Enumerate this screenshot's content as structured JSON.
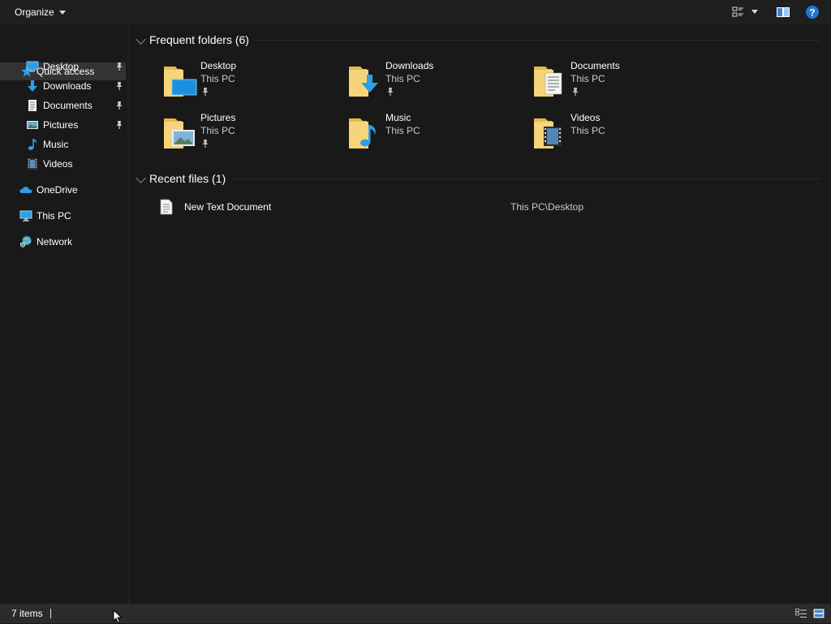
{
  "toolbar": {
    "organize_label": "Organize",
    "icons": [
      "view-options-icon",
      "preview-pane-icon",
      "help-icon"
    ]
  },
  "sidebar": {
    "quick_access": "Quick access",
    "pinned": [
      {
        "label": "Desktop",
        "icon": "desktop-icon"
      },
      {
        "label": "Downloads",
        "icon": "downloads-icon"
      },
      {
        "label": "Documents",
        "icon": "documents-icon"
      },
      {
        "label": "Pictures",
        "icon": "pictures-icon"
      }
    ],
    "items": [
      {
        "label": "Music",
        "icon": "music-icon"
      },
      {
        "label": "Videos",
        "icon": "videos-icon"
      }
    ],
    "onedrive": "OneDrive",
    "this_pc": "This PC",
    "network": "Network"
  },
  "frequent": {
    "title": "Frequent folders (6)",
    "folders": [
      {
        "name": "Desktop",
        "location": "This PC",
        "pinned": true
      },
      {
        "name": "Downloads",
        "location": "This PC",
        "pinned": true
      },
      {
        "name": "Documents",
        "location": "This PC",
        "pinned": true
      },
      {
        "name": "Pictures",
        "location": "This PC",
        "pinned": true
      },
      {
        "name": "Music",
        "location": "This PC",
        "pinned": false
      },
      {
        "name": "Videos",
        "location": "This PC",
        "pinned": false
      }
    ]
  },
  "recent": {
    "title": "Recent files (1)",
    "files": [
      {
        "name": "New Text Document",
        "path": "This PC\\Desktop"
      }
    ]
  },
  "status": {
    "item_count": "7 items"
  },
  "colors": {
    "background": "#191919",
    "selected": "#333333",
    "folder_yellow": "#f4cd6a",
    "accent_blue": "#2d9fe6"
  }
}
